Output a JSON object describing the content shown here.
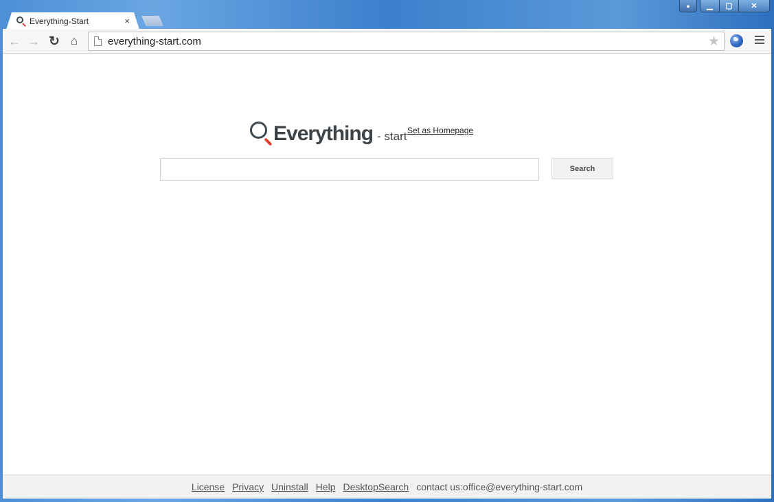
{
  "window": {
    "controls": {
      "profile_icon": "person-icon",
      "minimize_icon": "minimize-icon",
      "maximize_icon": "maximize-icon",
      "close_icon": "close-icon",
      "minimize_glyph": "▁",
      "maximize_glyph": "▢",
      "close_glyph": "✕",
      "profile_glyph": "👤"
    }
  },
  "tabs": [
    {
      "title": "Everything-Start",
      "icon": "magnifier-icon",
      "close_glyph": "×"
    }
  ],
  "toolbar": {
    "back_glyph": "←",
    "forward_glyph": "→",
    "reload_glyph": "↻",
    "home_glyph": "⌂",
    "url": "everything-start.com",
    "star_glyph": "★"
  },
  "page": {
    "logo": {
      "word": "Everything",
      "suffix": "- start"
    },
    "set_homepage": "Set as Homepage",
    "search": {
      "value": "",
      "placeholder": "",
      "button_label": "Search"
    },
    "colors": {
      "logo_text": "#3e4347",
      "logo_handle": "#e0402f"
    }
  },
  "footer": {
    "links": [
      "License",
      "Privacy",
      "Uninstall",
      "Help",
      "DesktopSearch"
    ],
    "contact": "contact us:office@everything-start.com"
  }
}
